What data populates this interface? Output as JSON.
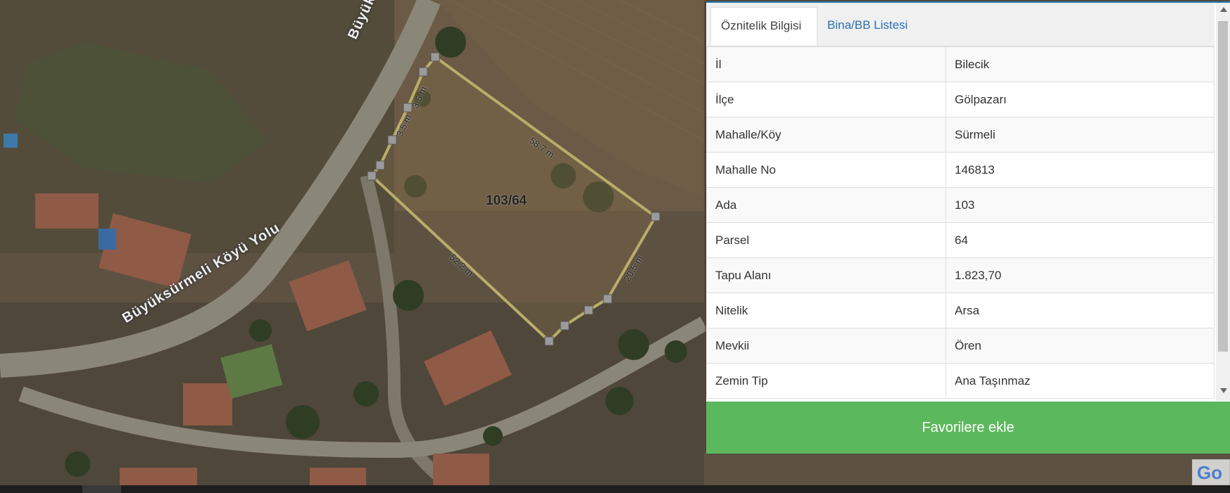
{
  "map": {
    "road_label_1": "Büyüksürmeli",
    "road_label_2": "Büyüksürmeli Köyü Yolu",
    "parcel_label": "103/64",
    "edge_labels": [
      "58.7 m",
      "20.5 m",
      "52.2 m",
      "3.5 m",
      "3.5 m"
    ],
    "google_logo_text": "Go"
  },
  "panel": {
    "tabs": [
      {
        "label": "Öznitelik Bilgisi",
        "active": true
      },
      {
        "label": "Bina/BB Listesi",
        "active": false
      }
    ],
    "rows": [
      {
        "key": "İl",
        "value": "Bilecik"
      },
      {
        "key": "İlçe",
        "value": "Gölpazarı"
      },
      {
        "key": "Mahalle/Köy",
        "value": "Sürmeli"
      },
      {
        "key": "Mahalle No",
        "value": "146813"
      },
      {
        "key": "Ada",
        "value": "103"
      },
      {
        "key": "Parsel",
        "value": "64"
      },
      {
        "key": "Tapu Alanı",
        "value": "1.823,70"
      },
      {
        "key": "Nitelik",
        "value": "Arsa"
      },
      {
        "key": "Mevkii",
        "value": "Ören"
      },
      {
        "key": "Zemin Tip",
        "value": "Ana Taşınmaz"
      }
    ],
    "favorite_button_label": "Favorilere ekle"
  },
  "colors": {
    "accent_green": "#5cb85c",
    "tab_link": "#2a6fb0",
    "parcel_outline": "#b9ad6a"
  }
}
